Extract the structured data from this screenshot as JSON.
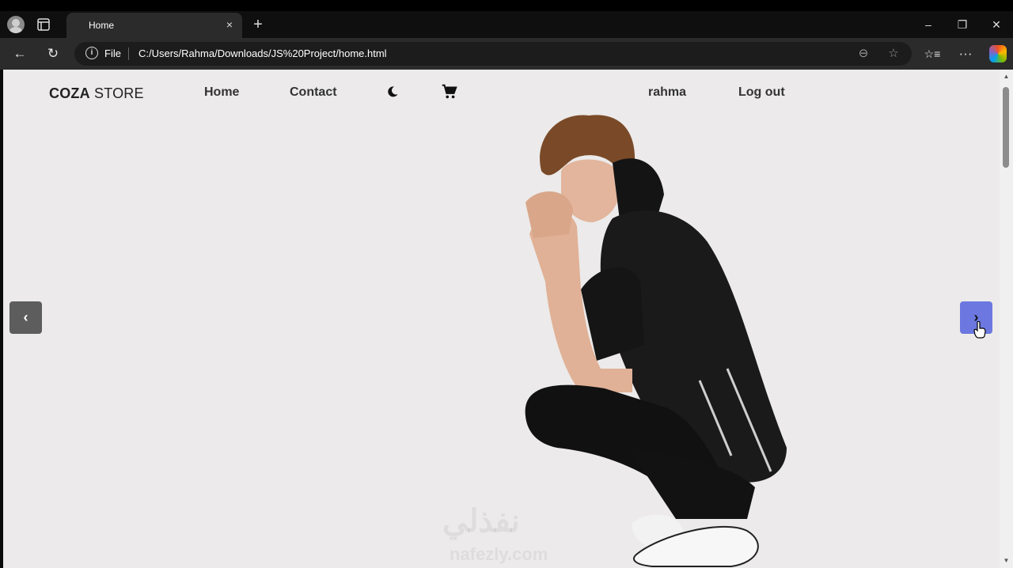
{
  "browser": {
    "tab_title": "Home",
    "close_tab": "×",
    "new_tab": "+",
    "address_scheme": "File",
    "address_url": "C:/Users/Rahma/Downloads/JS%20Project/home.html",
    "window": {
      "minimize": "–",
      "restore": "❐",
      "close": "✕"
    },
    "toolbar": {
      "back": "←",
      "reload": "↻",
      "favorites": "☆",
      "collections": "☆≡",
      "more": "···",
      "zoom": "⊖"
    }
  },
  "site": {
    "logo_bold": "COZA",
    "logo_rest": " STORE",
    "nav": {
      "home": "Home",
      "contact": "Contact",
      "user": "rahma",
      "logout": "Log out"
    },
    "slider": {
      "prev": "‹",
      "next": "›"
    },
    "watermark": {
      "line1": "نفذلي",
      "line2": "nafezly.com"
    }
  },
  "colors": {
    "page_bg": "#eceaea",
    "next_button": "#6c78e0",
    "prev_button": "#5d5d5d"
  }
}
